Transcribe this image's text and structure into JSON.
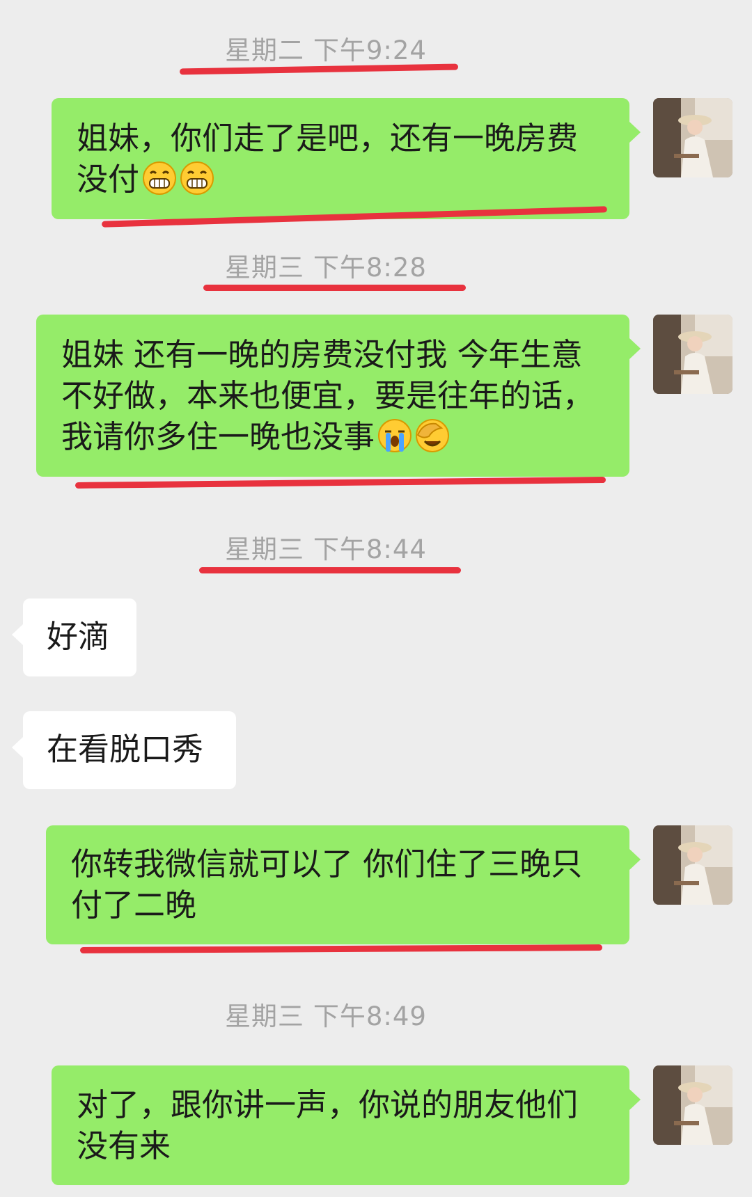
{
  "messages": [
    {
      "type": "timestamp",
      "text": "星期二 下午9:24"
    },
    {
      "type": "sent",
      "text": "姐妹，你们走了是吧，还有一晚房费没付",
      "emoji": [
        "grin-emoji",
        "grin-emoji"
      ]
    },
    {
      "type": "timestamp",
      "text": "星期三 下午8:28"
    },
    {
      "type": "sent",
      "text": "姐妹 还有一晚的房费没付我 今年生意不好做，本来也便宜，要是往年的话，我请你多住一晚也没事",
      "emoji": [
        "crying-emoji",
        "facepalm-emoji"
      ]
    },
    {
      "type": "timestamp",
      "text": "星期三 下午8:44"
    },
    {
      "type": "received",
      "text": "好滴"
    },
    {
      "type": "received",
      "text": "在看脱口秀"
    },
    {
      "type": "sent",
      "text": "你转我微信就可以了 你们住了三晚只付了二晚"
    },
    {
      "type": "timestamp",
      "text": "星期三 下午8:49"
    },
    {
      "type": "sent",
      "text": "对了，跟你讲一声，你说的朋友他们没有来"
    }
  ],
  "colors": {
    "background": "#ededed",
    "sent_bubble": "#95ec69",
    "received_bubble": "#ffffff",
    "timestamp_text": "#a3a3a3",
    "annotation_underline": "#e8323e"
  }
}
